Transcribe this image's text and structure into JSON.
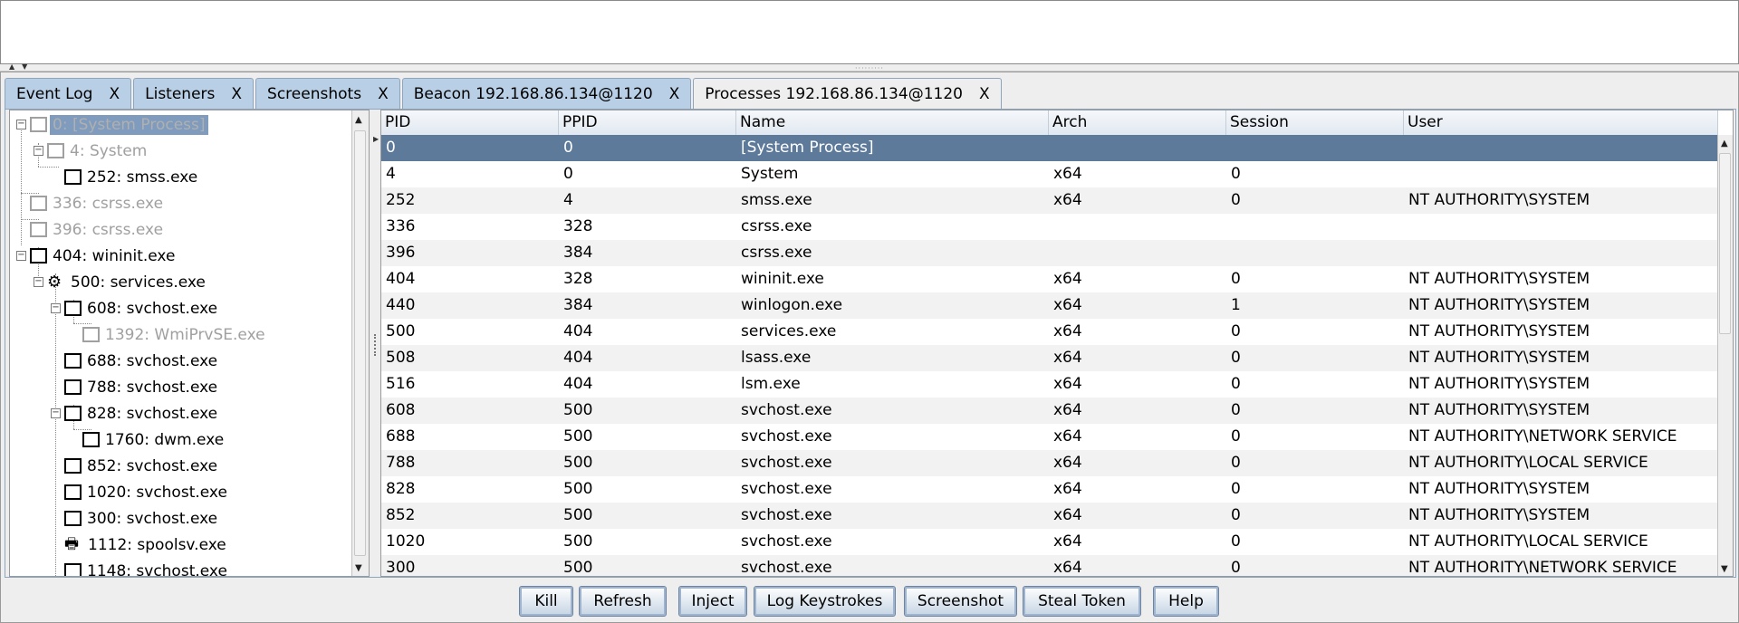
{
  "tabs": [
    {
      "label": "Event Log",
      "close": "X",
      "active": false
    },
    {
      "label": "Listeners",
      "close": "X",
      "active": false
    },
    {
      "label": "Screenshots",
      "close": "X",
      "active": false
    },
    {
      "label": "Beacon 192.168.86.134@1120",
      "close": "X",
      "active": false
    },
    {
      "label": "Processes 192.168.86.134@1120",
      "close": "X",
      "active": true
    }
  ],
  "tree": [
    {
      "label": "0: [System Process]",
      "state": "selected"
    },
    {
      "label": "4: System",
      "state": "disabled"
    },
    {
      "label": "252: smss.exe",
      "state": "normal"
    },
    {
      "label": "336: csrss.exe",
      "state": "disabled"
    },
    {
      "label": "396: csrss.exe",
      "state": "disabled"
    },
    {
      "label": "404: wininit.exe",
      "state": "normal"
    },
    {
      "label": "500: services.exe",
      "state": "normal",
      "icon": "gear-icon"
    },
    {
      "label": "608: svchost.exe",
      "state": "normal"
    },
    {
      "label": "1392: WmiPrvSE.exe",
      "state": "disabled"
    },
    {
      "label": "688: svchost.exe",
      "state": "normal"
    },
    {
      "label": "788: svchost.exe",
      "state": "normal"
    },
    {
      "label": "828: svchost.exe",
      "state": "normal"
    },
    {
      "label": "1760: dwm.exe",
      "state": "normal"
    },
    {
      "label": "852: svchost.exe",
      "state": "normal"
    },
    {
      "label": "1020: svchost.exe",
      "state": "normal"
    },
    {
      "label": "300: svchost.exe",
      "state": "normal"
    },
    {
      "label": "1112: spoolsv.exe",
      "state": "normal",
      "icon": "printer-icon"
    },
    {
      "label": "1148: svchost.exe",
      "state": "normal"
    }
  ],
  "table": {
    "columns": [
      "PID",
      "PPID",
      "Name",
      "Arch",
      "Session",
      "User"
    ],
    "rows": [
      [
        "0",
        "0",
        "[System Process]",
        "",
        "",
        ""
      ],
      [
        "4",
        "0",
        "System",
        "x64",
        "0",
        ""
      ],
      [
        "252",
        "4",
        "smss.exe",
        "x64",
        "0",
        "NT AUTHORITY\\SYSTEM"
      ],
      [
        "336",
        "328",
        "csrss.exe",
        "",
        "",
        ""
      ],
      [
        "396",
        "384",
        "csrss.exe",
        "",
        "",
        ""
      ],
      [
        "404",
        "328",
        "wininit.exe",
        "x64",
        "0",
        "NT AUTHORITY\\SYSTEM"
      ],
      [
        "440",
        "384",
        "winlogon.exe",
        "x64",
        "1",
        "NT AUTHORITY\\SYSTEM"
      ],
      [
        "500",
        "404",
        "services.exe",
        "x64",
        "0",
        "NT AUTHORITY\\SYSTEM"
      ],
      [
        "508",
        "404",
        "lsass.exe",
        "x64",
        "0",
        "NT AUTHORITY\\SYSTEM"
      ],
      [
        "516",
        "404",
        "lsm.exe",
        "x64",
        "0",
        "NT AUTHORITY\\SYSTEM"
      ],
      [
        "608",
        "500",
        "svchost.exe",
        "x64",
        "0",
        "NT AUTHORITY\\SYSTEM"
      ],
      [
        "688",
        "500",
        "svchost.exe",
        "x64",
        "0",
        "NT AUTHORITY\\NETWORK SERVICE"
      ],
      [
        "788",
        "500",
        "svchost.exe",
        "x64",
        "0",
        "NT AUTHORITY\\LOCAL SERVICE"
      ],
      [
        "828",
        "500",
        "svchost.exe",
        "x64",
        "0",
        "NT AUTHORITY\\SYSTEM"
      ],
      [
        "852",
        "500",
        "svchost.exe",
        "x64",
        "0",
        "NT AUTHORITY\\SYSTEM"
      ],
      [
        "1020",
        "500",
        "svchost.exe",
        "x64",
        "0",
        "NT AUTHORITY\\LOCAL SERVICE"
      ],
      [
        "300",
        "500",
        "svchost.exe",
        "x64",
        "0",
        "NT AUTHORITY\\NETWORK SERVICE"
      ]
    ]
  },
  "buttons": {
    "kill": "Kill",
    "refresh": "Refresh",
    "inject": "Inject",
    "log_keystrokes": "Log Keystrokes",
    "screenshot": "Screenshot",
    "steal_token": "Steal Token",
    "help": "Help"
  },
  "colors": {
    "tab_inactive": "#b8cfe5",
    "selection": "#5e7a9b",
    "tree_selection": "#7f9bbd"
  }
}
